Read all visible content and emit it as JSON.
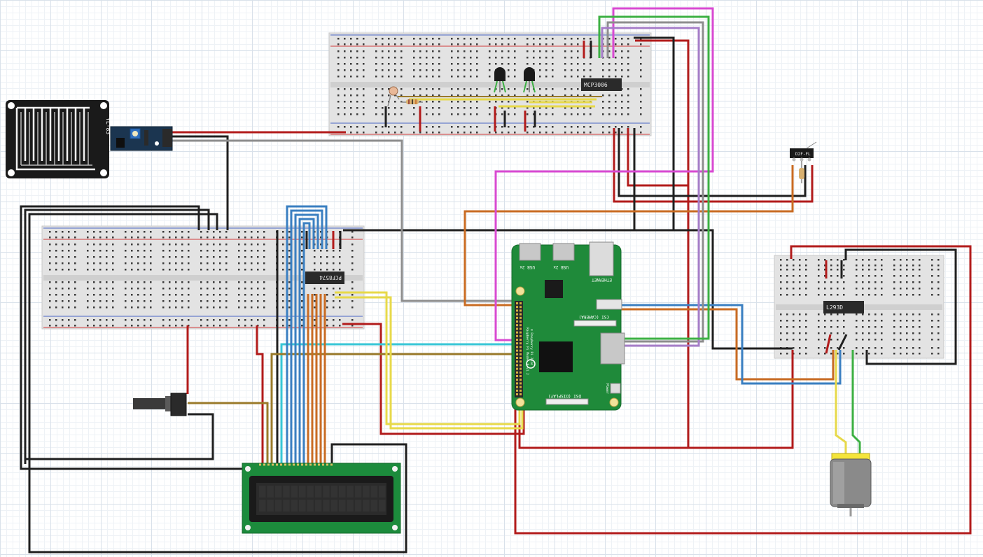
{
  "labels": {
    "adc_chip": "MCP3006",
    "io_expander_chip": "PCF8574",
    "driver_chip": "L293D",
    "rain_module": "YL-83",
    "limit_switch": "D2F-FL",
    "usb_left": "USB 2x",
    "usb_right": "USB 2x",
    "ethernet": "ETHERNET",
    "camera": "CSI (CAMERA)",
    "display": "DSI (DISPLAY)",
    "power": "Power",
    "pi_model": "Raspberry Pi Model B v1.2",
    "pi_copyright": "© Raspberry Pi 2014"
  },
  "colors": {
    "red": "#b21b1b",
    "black": "#1f1f1f",
    "gray": "#8d8d8d",
    "orange": "#c96b22",
    "blue": "#3a7fc1",
    "yellow": "#e7d94a",
    "green": "#3cb043",
    "magenta": "#d84ad2",
    "violet": "#a67dc8",
    "olive": "#9a7a2a",
    "cyan": "#37c6d6",
    "pi_green": "#1f8a3a",
    "lcd_green": "#1c8b3c",
    "breadboard": "#e4e4e4"
  }
}
